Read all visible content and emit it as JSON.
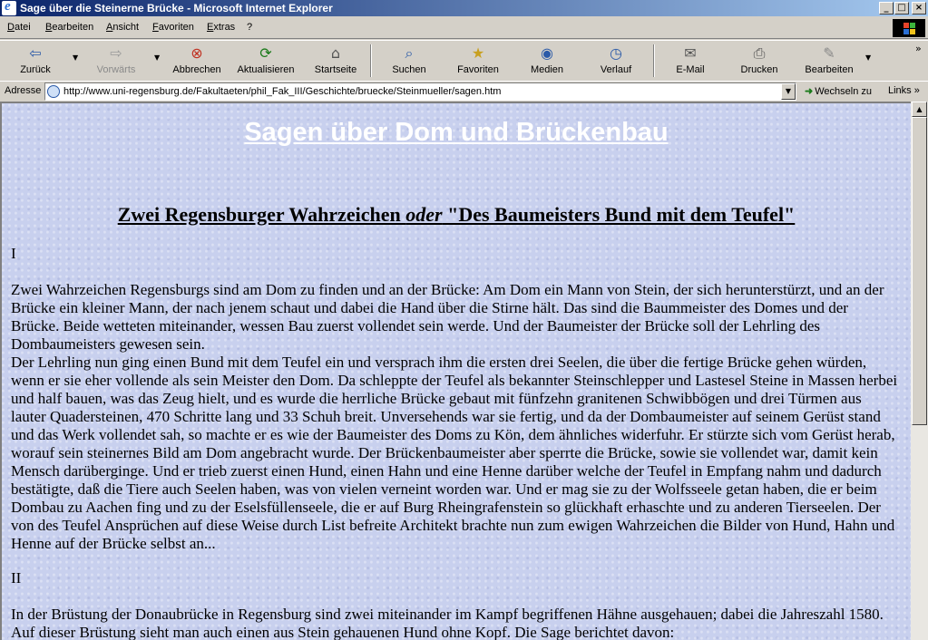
{
  "window": {
    "title": "Sage über die Steinerne Brücke - Microsoft Internet Explorer",
    "controls": {
      "minimize": "_",
      "maximize": "□",
      "close": "×"
    }
  },
  "menu": {
    "items": [
      {
        "label": "Datei"
      },
      {
        "label": "Bearbeiten"
      },
      {
        "label": "Ansicht"
      },
      {
        "label": "Favoriten"
      },
      {
        "label": "Extras"
      },
      {
        "label": "?"
      }
    ]
  },
  "toolbar": {
    "back": {
      "label": "Zurück",
      "icon": "back-arrow-icon"
    },
    "forward": {
      "label": "Vorwärts",
      "icon": "forward-arrow-icon"
    },
    "stop": {
      "label": "Abbrechen",
      "icon": "stop-icon"
    },
    "refresh": {
      "label": "Aktualisieren",
      "icon": "refresh-icon"
    },
    "home": {
      "label": "Startseite",
      "icon": "home-icon"
    },
    "search": {
      "label": "Suchen",
      "icon": "search-icon"
    },
    "favorites": {
      "label": "Favoriten",
      "icon": "favorites-icon"
    },
    "media": {
      "label": "Medien",
      "icon": "media-icon"
    },
    "history": {
      "label": "Verlauf",
      "icon": "history-icon"
    },
    "mail": {
      "label": "E-Mail",
      "icon": "mail-icon"
    },
    "print": {
      "label": "Drucken",
      "icon": "print-icon"
    },
    "edit": {
      "label": "Bearbeiten",
      "icon": "edit-icon"
    }
  },
  "address": {
    "label": "Adresse",
    "url": "http://www.uni-regensburg.de/Fakultaeten/phil_Fak_III/Geschichte/bruecke/Steinmueller/sagen.htm",
    "go_label": "Wechseln zu",
    "links_label": "Links"
  },
  "page": {
    "title": "Sagen über Dom und Brückenbau",
    "heading_pre": "Zwei Regensburger Wahrzeichen ",
    "heading_em": "oder",
    "heading_post": " \"Des Baumeisters Bund mit dem Teufel\"",
    "section1": "I",
    "para1": "Zwei Wahrzeichen Regensburgs sind am Dom zu finden und an der Brücke: Am Dom ein Mann von Stein, der sich herunterstürzt, und an der Brücke ein kleiner Mann, der nach jenem schaut und dabei die Hand über die Stirne hält. Das sind die Baummeister des Domes und der Brücke. Beide wetteten miteinander, wessen Bau zuerst vollendet sein werde. Und der Baumeister der Brücke soll der Lehrling des Dombaumeisters gewesen sein.",
    "para2": "Der Lehrling nun ging einen Bund mit dem Teufel ein und versprach ihm die ersten drei Seelen, die über die fertige Brücke gehen würden, wenn er sie eher vollende als sein Meister den Dom. Da schleppte der Teufel als bekannter Steinschlepper und Lastesel Steine in Massen herbei und half bauen, was das Zeug hielt, und es wurde die herrliche Brücke gebaut mit fünfzehn granitenen Schwibbögen und drei Türmen aus lauter Quadersteinen, 470 Schritte lang und 33 Schuh breit. Unversehends war sie fertig, und da der Dombaumeister auf seinem Gerüst stand und das Werk vollendet sah, so machte er es wie der Baumeister des Doms zu Kön, dem ähnliches widerfuhr. Er stürzte sich vom Gerüst herab, worauf sein steinernes Bild am Dom angebracht wurde. Der Brückenbaumeister aber sperrte die Brücke, sowie sie vollendet war, damit kein Mensch darüberginge. Und er trieb zuerst einen Hund, einen Hahn und eine Henne darüber welche der Teufel in Empfang nahm und dadurch bestätigte, daß die Tiere auch Seelen haben, was von vielen verneint worden war. Und er mag sie zu der Wolfsseele getan haben, die er beim Dombau zu Aachen fing und zu der Eselsfüllenseele, die er auf Burg Rheingrafenstein so glückhaft erhaschte und zu anderen Tierseelen. Der von des Teufel Ansprüchen auf diese Weise durch List befreite Architekt brachte nun zum ewigen Wahrzeichen die Bilder von Hund, Hahn und Henne auf der Brücke selbst an...",
    "section2": "II",
    "para3": "In der Brüstung der Donaubrücke in Regensburg sind zwei miteinander im Kampf begriffenen Hähne ausgehauen; dabei die Jahreszahl 1580. Auf dieser Brüstung sieht man auch einen aus Stein gehauenen Hund ohne Kopf. Die Sage berichtet davon:"
  },
  "colors": {
    "titlebar_start": "#0a246a",
    "titlebar_end": "#a6caf0",
    "chrome": "#d4d0c8",
    "page_background": "#c8d0ee",
    "page_title": "#ffffff"
  }
}
